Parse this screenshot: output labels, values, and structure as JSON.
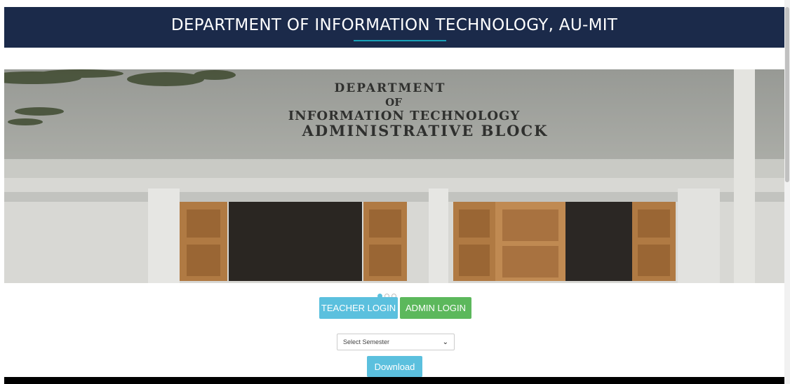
{
  "header": {
    "title": "DEPARTMENT OF INFORMATION TECHNOLOGY, AU-MIT"
  },
  "carousel": {
    "image_text_lines": [
      "DEPARTMENT",
      "OF",
      "INFORMATION TECHNOLOGY",
      "ADMINISTRATIVE BLOCK"
    ],
    "active_index": 0
  },
  "buttons": {
    "teacher_login": "TEACHER LOGIN",
    "admin_login": "ADMIN LOGIN",
    "download": "Download"
  },
  "semester_select": {
    "selected": "Select Semester"
  },
  "colors": {
    "header_bg": "#1b2a4a",
    "info": "#5bc0de",
    "success": "#5cb85c"
  }
}
